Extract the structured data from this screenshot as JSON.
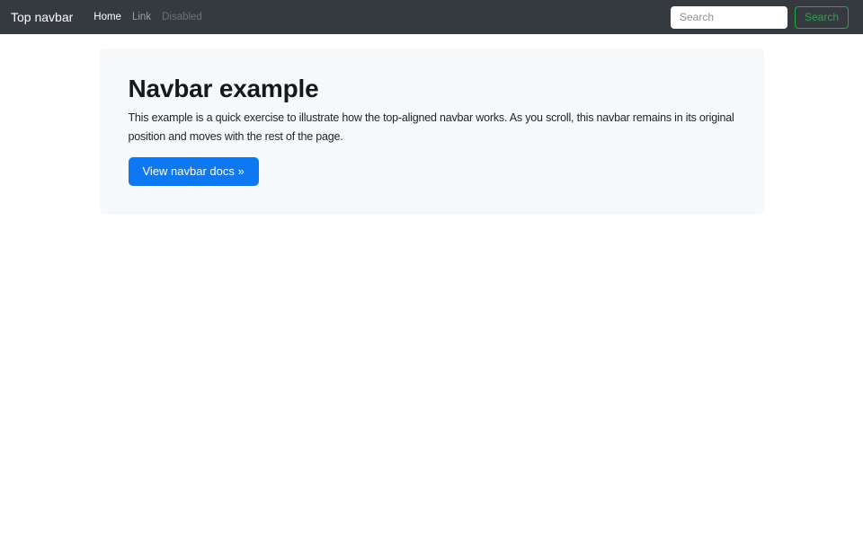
{
  "navbar": {
    "brand": "Top navbar",
    "links": [
      {
        "label": "Home",
        "state": "active"
      },
      {
        "label": "Link",
        "state": "normal"
      },
      {
        "label": "Disabled",
        "state": "disabled"
      }
    ],
    "search": {
      "placeholder": "Search",
      "button_label": "Search"
    }
  },
  "hero": {
    "title": "Navbar example",
    "description": "This example is a quick exercise to illustrate how the top-aligned navbar works. As you scroll, this navbar remains in its original position and moves with the rest of the page.",
    "cta_label": "View navbar docs »"
  },
  "colors": {
    "navbar_bg": "#343a40",
    "hero_bg": "#f7f8f9",
    "primary_button": "#0d78f2",
    "success_outline": "#28a745",
    "nav_link_muted": "rgba(255,255,255,0.5)",
    "nav_link_disabled": "rgba(255,255,255,0.28)",
    "body_text": "#212529"
  }
}
